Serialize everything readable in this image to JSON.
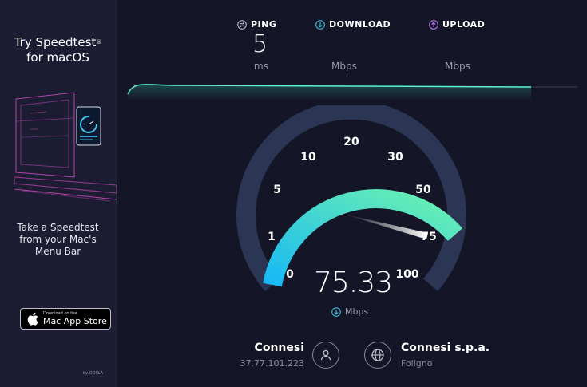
{
  "ad": {
    "title_line1": "Try Speedtest",
    "title_line2": "for macOS",
    "description_line1": "Take a Speedtest",
    "description_line2": "from your Mac's",
    "description_line3": "Menu Bar",
    "appstore_small": "Download on the",
    "appstore_big": "Mac App Store",
    "byline": "by OOKLA"
  },
  "metrics": {
    "ping": {
      "label": "PING",
      "value": "5",
      "unit": "ms",
      "icon": "ping-arrows-icon"
    },
    "download": {
      "label": "DOWNLOAD",
      "unit": "Mbps",
      "icon": "download-arrow-icon"
    },
    "upload": {
      "label": "UPLOAD",
      "unit": "Mbps",
      "icon": "upload-arrow-icon"
    }
  },
  "gauge": {
    "ticks": [
      "0",
      "1",
      "5",
      "10",
      "20",
      "30",
      "50",
      "75",
      "100"
    ],
    "current_value": "75.33",
    "current_unit": "Mbps"
  },
  "isp": {
    "name": "Connesi",
    "ip": "37.77.101.223"
  },
  "server": {
    "name": "Connesi s.p.a.",
    "location": "Foligno"
  },
  "colors": {
    "background": "#141526",
    "sidebar": "#1c1d33",
    "gauge_start": "#17b8f5",
    "gauge_end": "#6cf2b0",
    "gauge_track": "#2b3654",
    "ping_icon": "#c7c7d4",
    "download_icon": "#3ec6e8",
    "upload_icon": "#c67bff"
  }
}
